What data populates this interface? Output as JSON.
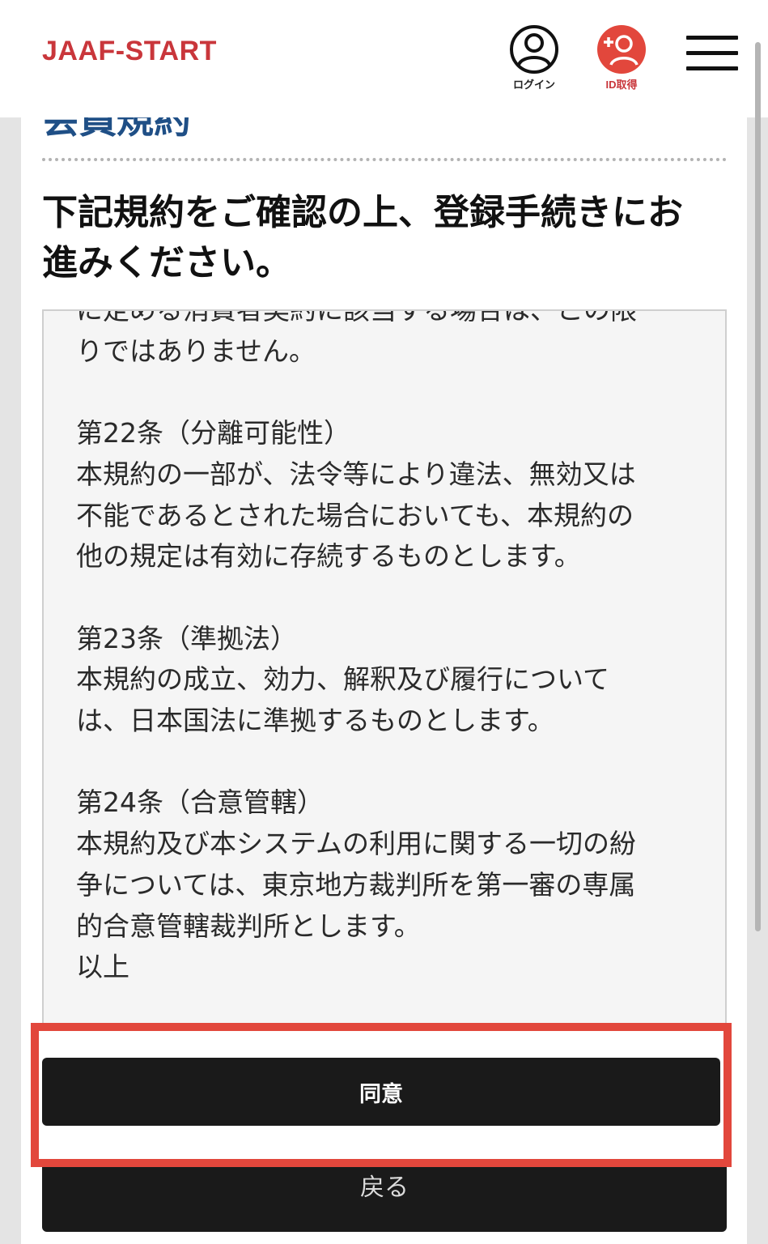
{
  "header": {
    "logo": "JAAF-START",
    "login_label": "ログイン",
    "id_label": "ID取得"
  },
  "page": {
    "section_title": "会員規約",
    "instruction_line1": "下記規約をご確認の上、登録手続きにお",
    "instruction_line2": "進みください。"
  },
  "terms": {
    "lines": [
      "に定める消費者契約に該当する場合は、この限",
      "りではありません。",
      "",
      "第22条（分離可能性）",
      "本規約の一部が、法令等により違法、無効又は",
      "不能であるとされた場合においても、本規約の",
      "他の規定は有効に存続するものとします。",
      "",
      "第23条（準拠法）",
      "本規約の成立、効力、解釈及び履行について",
      "は、日本国法に準拠するものとします。",
      "",
      "第24条（合意管轄）",
      "本規約及び本システムの利用に関する一切の紛",
      "争については、東京地方裁判所を第一審の専属",
      "的合意管轄裁判所とします。",
      "以上"
    ]
  },
  "buttons": {
    "agree": "同意",
    "back": "戻る"
  },
  "colors": {
    "brand_red": "#c9363b",
    "title_blue": "#1f4f86",
    "highlight_red": "#e2473c",
    "button_dark": "#1a1a1a"
  },
  "icons": {
    "login": "user-circle-icon",
    "id": "add-user-icon",
    "menu": "hamburger-menu-icon"
  }
}
